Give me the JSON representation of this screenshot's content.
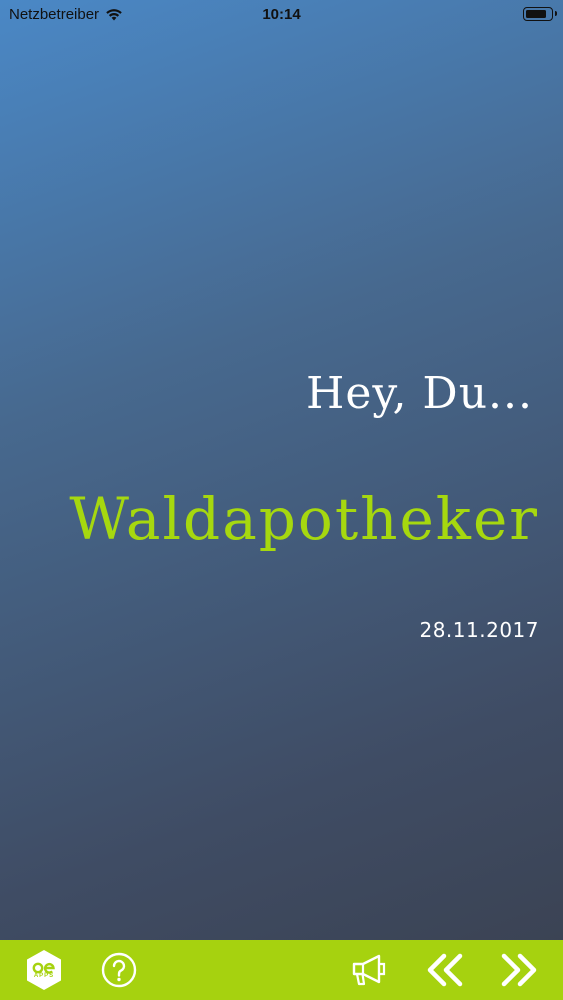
{
  "status_bar": {
    "carrier": "Netzbetreiber",
    "time": "10:14",
    "battery_level": 0.85
  },
  "content": {
    "greeting": "Hey, Du...",
    "title": "Waldapotheker",
    "date": "28.11.2017"
  },
  "toolbar": {
    "background_color": "#a6d20f",
    "logo_main": "oe",
    "logo_sub": "APPS",
    "icons": [
      "app-logo-icon",
      "help-icon",
      "megaphone-icon",
      "previous-icon",
      "next-icon"
    ]
  },
  "colors": {
    "title": "#a6d80f",
    "text": "#ffffff",
    "background_top": "#4a88c6",
    "background_bottom": "#3a4150"
  }
}
